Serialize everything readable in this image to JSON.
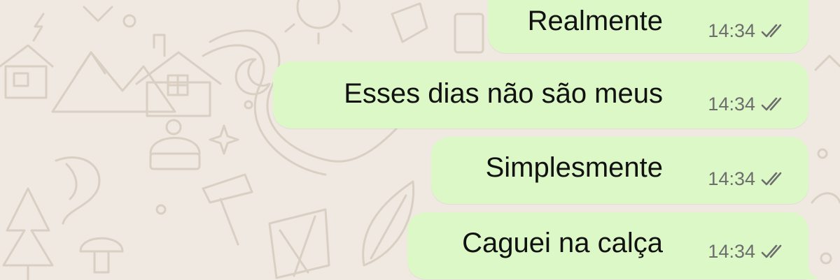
{
  "chat": {
    "messages": [
      {
        "text": "Realmente",
        "time": "14:34",
        "status": "read-double-check-icon"
      },
      {
        "text": "Esses dias não são meus",
        "time": "14:34",
        "status": "read-double-check-icon"
      },
      {
        "text": "Simplesmente",
        "time": "14:34",
        "status": "read-double-check-icon"
      },
      {
        "text": "Caguei na calça",
        "time": "14:34",
        "status": "read-double-check-icon"
      }
    ]
  },
  "colors": {
    "wallpaper": "#efe9e2",
    "doodle": "#d9cfc3",
    "outgoing_bubble": "#dcf8c6",
    "text": "#111111",
    "timestamp": "#6d6d6d",
    "ticks": "#6d6d6d"
  }
}
